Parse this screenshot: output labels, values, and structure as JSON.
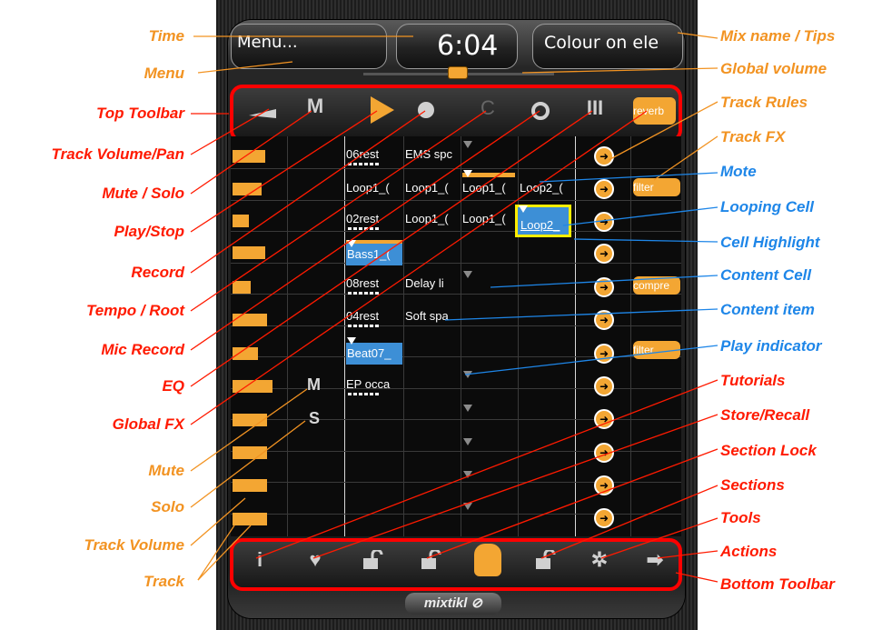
{
  "top": {
    "menu_label": "Menu...",
    "time": "6:04",
    "mix_name": "Colour on ele"
  },
  "top_toolbar": {
    "fx_label": "reverb"
  },
  "track_fx_labels": [
    "filter",
    "compre",
    "filter"
  ],
  "cells": [
    {
      "label": "06rest",
      "style": "plain"
    },
    {
      "label": "EMS spc",
      "style": "plain"
    },
    {
      "label": "Loop1_(",
      "style": "plain"
    },
    {
      "label": "Loop1_(",
      "style": "plain"
    },
    {
      "label": "Loop1_(",
      "style": "plain"
    },
    {
      "label": "Loop2_(",
      "style": "plain"
    },
    {
      "label": "02rest",
      "style": "plain"
    },
    {
      "label": "Loop1_(",
      "style": "plain"
    },
    {
      "label": "Loop1_(",
      "style": "plain"
    },
    {
      "label": "Loop2_",
      "style": "highlight"
    },
    {
      "label": "Bass1_(",
      "style": "blue"
    },
    {
      "label": "08rest",
      "style": "plain"
    },
    {
      "label": "Delay li",
      "style": "plain"
    },
    {
      "label": "04rest",
      "style": "plain"
    },
    {
      "label": "Soft spa",
      "style": "plain"
    },
    {
      "label": "Beat07_",
      "style": "blue"
    },
    {
      "label": "EP occa",
      "style": "plain"
    }
  ],
  "track_letters": {
    "mute": "M",
    "solo": "S"
  },
  "logo": "mixtikl",
  "labels_left": [
    {
      "text": "Time",
      "color": "orange"
    },
    {
      "text": "Menu",
      "color": "orange"
    },
    {
      "text": "Top Toolbar",
      "color": "red"
    },
    {
      "text": "Track Volume/Pan",
      "color": "red"
    },
    {
      "text": "Mute / Solo",
      "color": "red"
    },
    {
      "text": "Play/Stop",
      "color": "red"
    },
    {
      "text": "Record",
      "color": "red"
    },
    {
      "text": "Tempo / Root",
      "color": "red"
    },
    {
      "text": "Mic Record",
      "color": "red"
    },
    {
      "text": "EQ",
      "color": "red"
    },
    {
      "text": "Global FX",
      "color": "red"
    },
    {
      "text": "Mute",
      "color": "orange"
    },
    {
      "text": "Solo",
      "color": "orange"
    },
    {
      "text": "Track Volume",
      "color": "orange"
    },
    {
      "text": "Track",
      "color": "orange"
    }
  ],
  "labels_right": [
    {
      "text": "Mix name / Tips",
      "color": "orange"
    },
    {
      "text": "Global volume",
      "color": "orange"
    },
    {
      "text": "Track Rules",
      "color": "orange"
    },
    {
      "text": "Track FX",
      "color": "orange"
    },
    {
      "text": "Mote",
      "color": "blue"
    },
    {
      "text": "Looping Cell",
      "color": "blue"
    },
    {
      "text": "Cell Highlight",
      "color": "blue"
    },
    {
      "text": "Content Cell",
      "color": "blue"
    },
    {
      "text": "Content item",
      "color": "blue"
    },
    {
      "text": "Play indicator",
      "color": "blue"
    },
    {
      "text": "Tutorials",
      "color": "red"
    },
    {
      "text": "Store/Recall",
      "color": "red"
    },
    {
      "text": "Section Lock",
      "color": "red"
    },
    {
      "text": "Sections",
      "color": "red"
    },
    {
      "text": "Tools",
      "color": "red"
    },
    {
      "text": "Actions",
      "color": "red"
    },
    {
      "text": "Bottom Toolbar",
      "color": "red"
    }
  ],
  "colors": {
    "red": "#ff1a00",
    "orange": "#f29322",
    "blue": "#1e86e8",
    "accent": "#f3a633",
    "highlight_border": "#ffee00"
  },
  "icons": {
    "top": [
      "track-volume-pan-icon",
      "mute-solo-icon",
      "play-icon",
      "record-icon",
      "tempo-root-icon",
      "mic-record-icon",
      "eq-icon"
    ],
    "bottom": [
      "info-icon",
      "heart-icon",
      "lock-icon",
      "lock-icon",
      "section-icon",
      "lock-icon",
      "gear-icon",
      "arrow-right-icon"
    ]
  }
}
